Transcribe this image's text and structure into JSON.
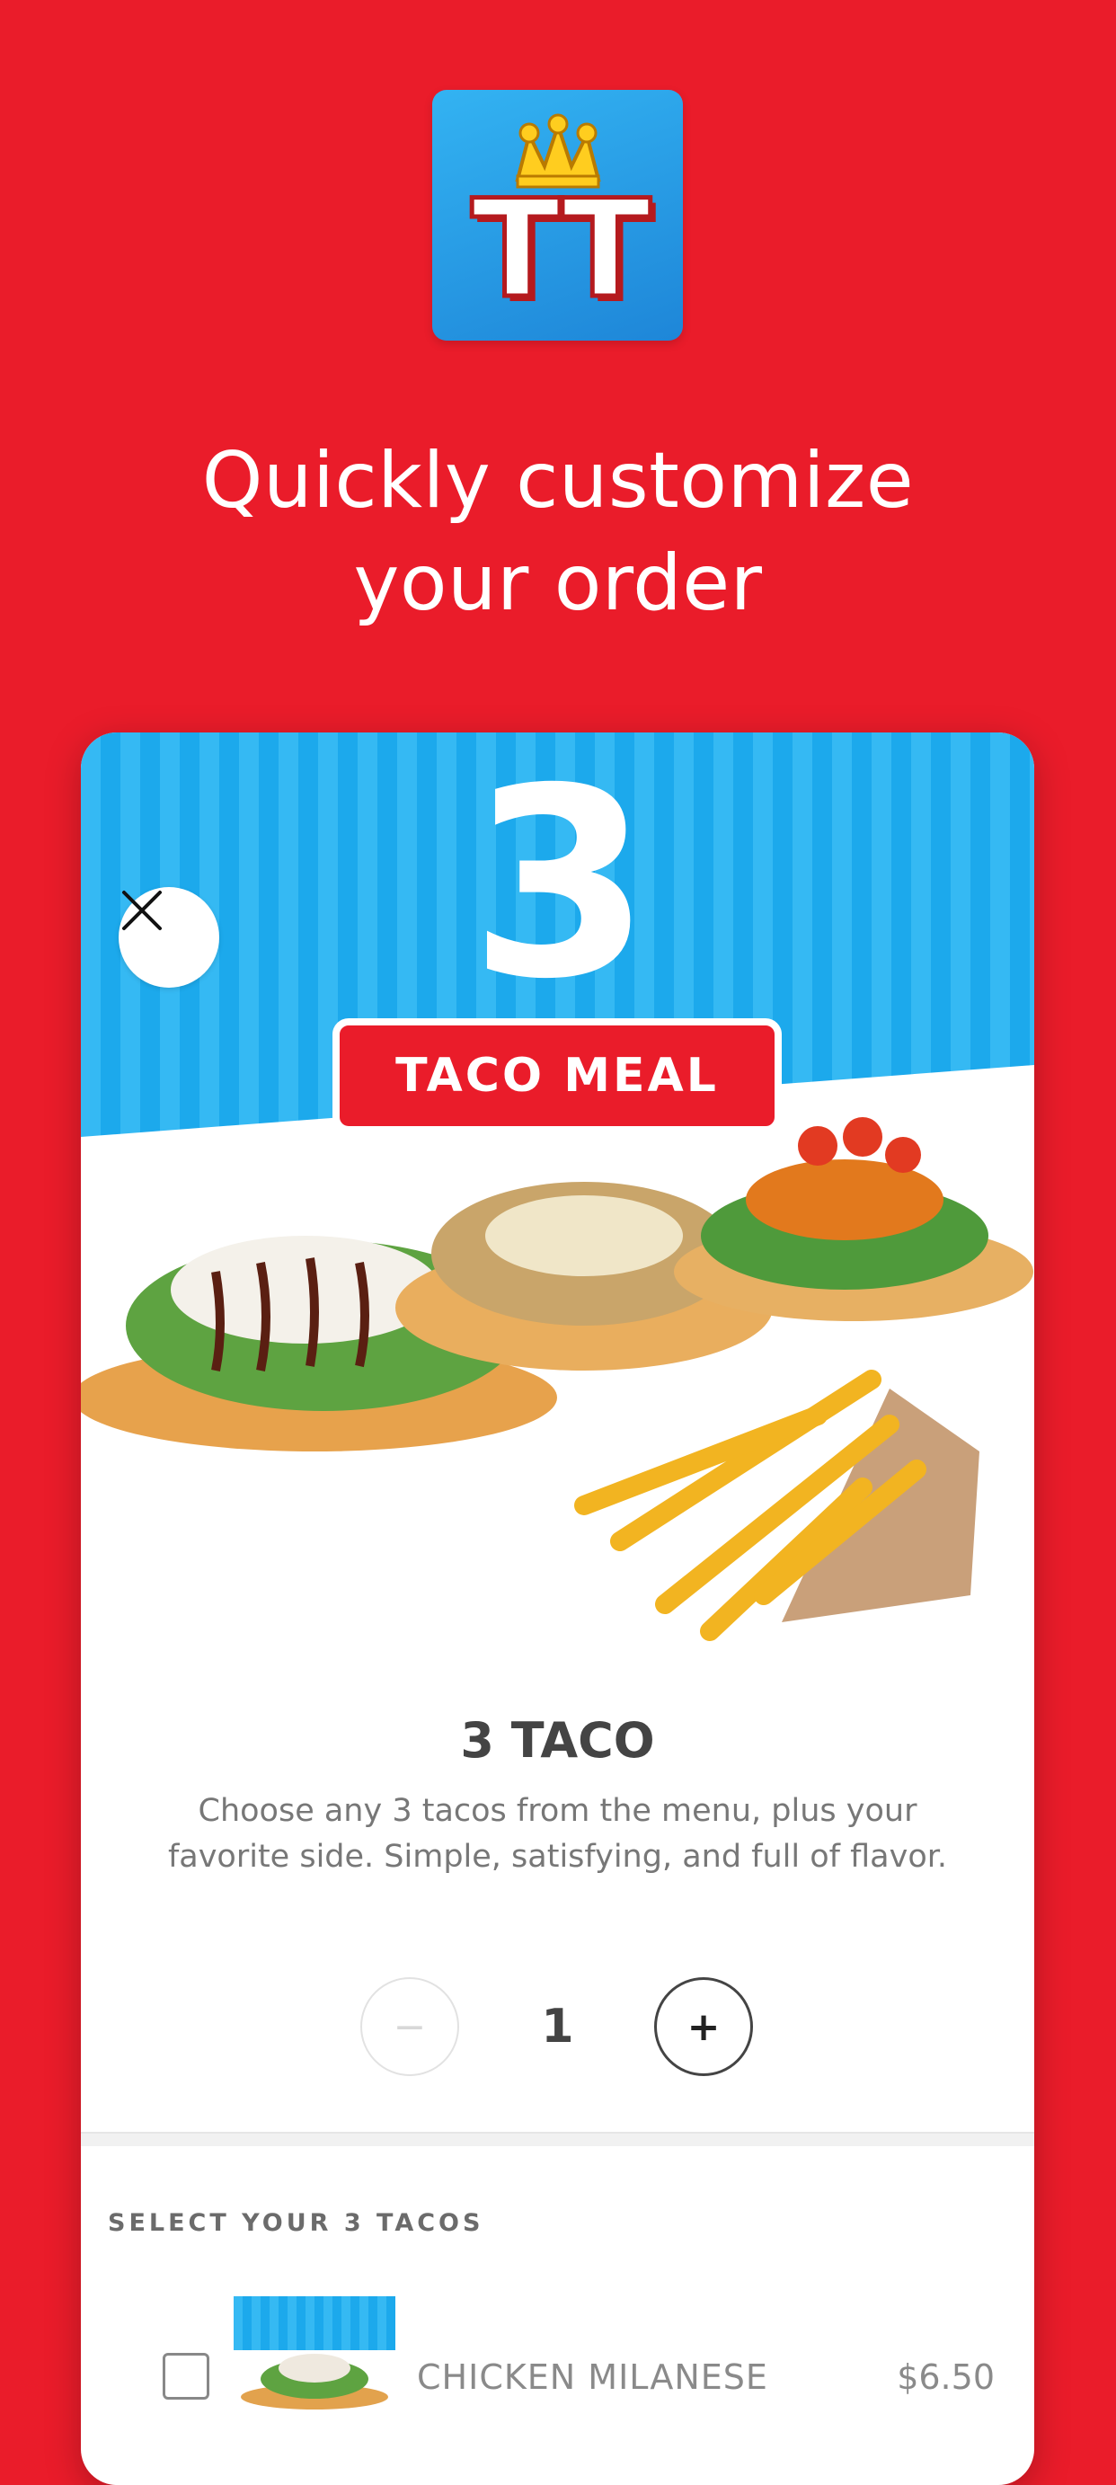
{
  "headline": {
    "line1": "Quickly customize",
    "line2": "your order"
  },
  "logo": {
    "text": "TT",
    "icon": "crown-icon"
  },
  "hero": {
    "big_number": "3",
    "badge": "TACO MEAL",
    "stripe_colors": [
      "#1ca9ec",
      "#35b9f3"
    ]
  },
  "product": {
    "title": "3 TACO",
    "description": "Choose any 3 tacos from the menu, plus your favorite side. Simple, satisfying, and full of flavor."
  },
  "stepper": {
    "minus": "−",
    "value": "1",
    "plus": "+"
  },
  "section": {
    "label": "SELECT YOUR 3 TACOS"
  },
  "options": [
    {
      "name": "CHICKEN MILANESE",
      "price": "$6.50",
      "checked": false
    }
  ],
  "colors": {
    "brand_red": "#ea1c2a",
    "sky_blue": "#1ca9ec",
    "text_dark": "#444444"
  }
}
